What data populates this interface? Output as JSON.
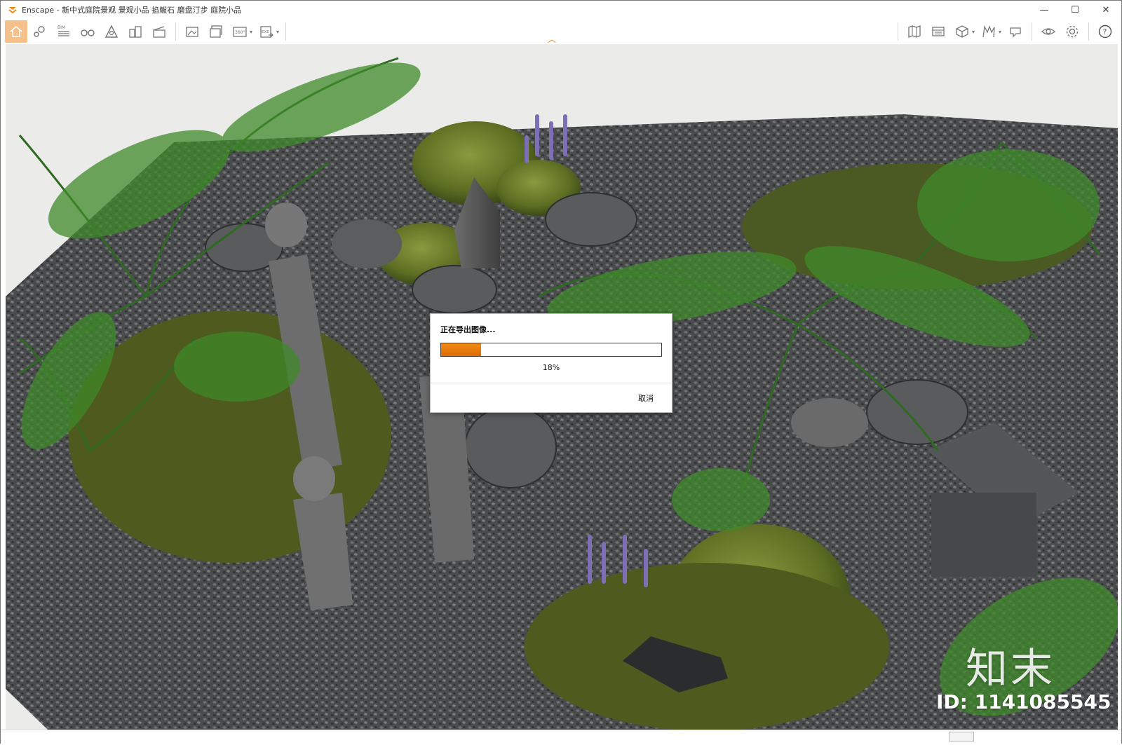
{
  "window": {
    "app_name": "Enscape",
    "title": "Enscape - 新中式庭院景观 景观小品 掐鲅石 磨盘汀步 庭院小品",
    "controls": {
      "minimize": "—",
      "maximize": "☐",
      "close": "✕"
    }
  },
  "toolbar": {
    "left_icons": [
      "home-icon",
      "map-pin-icon",
      "bim-icon",
      "binoculars-icon",
      "scene-icon",
      "buildings-icon",
      "clapper-icon",
      "screenshot-icon",
      "batch-render-icon",
      "panorama-360-icon",
      "exe-export-icon"
    ],
    "bim_label": "BIM",
    "panorama_label": "360°",
    "exe_label": "EXE",
    "right_icons": [
      "map-icon",
      "asset-library-icon",
      "cube-view-icon",
      "material-icon",
      "feedback-icon",
      "visibility-icon",
      "settings-icon",
      "help-icon"
    ],
    "accent": "#f5c08a"
  },
  "dialog": {
    "title": "正在导出图像...",
    "progress_percent": 18,
    "progress_text": "18%",
    "cancel_label": "取消",
    "progress_color": "#e87a10"
  },
  "watermark": {
    "logo": "知末",
    "id_text": "ID: 1141085545"
  }
}
